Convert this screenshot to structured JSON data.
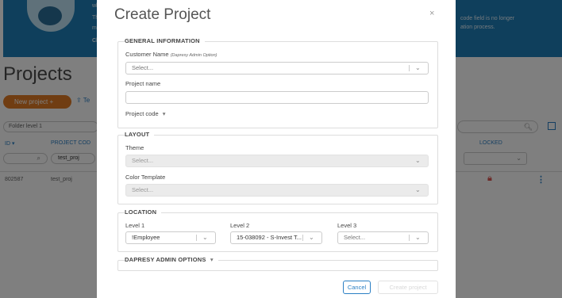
{
  "banner": {
    "left_lines": [
      "wh",
      "Th",
      "m",
      "Cl"
    ],
    "right_lines": [
      "code field is no longer",
      "ation process."
    ]
  },
  "page": {
    "title": "Projects",
    "new_project_label": "New project +",
    "share_label": "Te",
    "folder_placeholder": "Folder level 1",
    "columns": {
      "id": "ID ▾",
      "code": "PROJECT COD",
      "locked": "LOCKED"
    },
    "filter_code_value": "test_proj",
    "row": {
      "id": "802587",
      "code": "test_proj"
    }
  },
  "modal": {
    "title": "Create Project",
    "close": "×",
    "general": {
      "legend": "GENERAL INFORMATION",
      "customer_label": "Customer Name",
      "customer_note": "(Dapresy Admin Option)",
      "customer_placeholder": "Select...",
      "project_name_label": "Project name",
      "project_code_label": "Project code"
    },
    "layout": {
      "legend": "LAYOUT",
      "theme_label": "Theme",
      "theme_placeholder": "Select...",
      "color_label": "Color Template",
      "color_placeholder": "Select..."
    },
    "location": {
      "legend": "LOCATION",
      "level1_label": "Level 1",
      "level1_value": "!Employee",
      "level2_label": "Level 2",
      "level2_value": "15-038092 - S-Invest T...",
      "level3_label": "Level 3",
      "level3_placeholder": "Select..."
    },
    "admin": {
      "legend": "DAPRESY ADMIN OPTIONS"
    },
    "cancel_label": "Cancel",
    "create_label": "Create project"
  },
  "icons": {
    "chevron": "chevron-down-icon",
    "search": "search-icon",
    "lock": "lock-icon",
    "menu": "kebab-menu-icon"
  },
  "colors": {
    "accent": "#2a7fc4",
    "orange": "#e07b24",
    "banner": "#1f7fb8"
  }
}
